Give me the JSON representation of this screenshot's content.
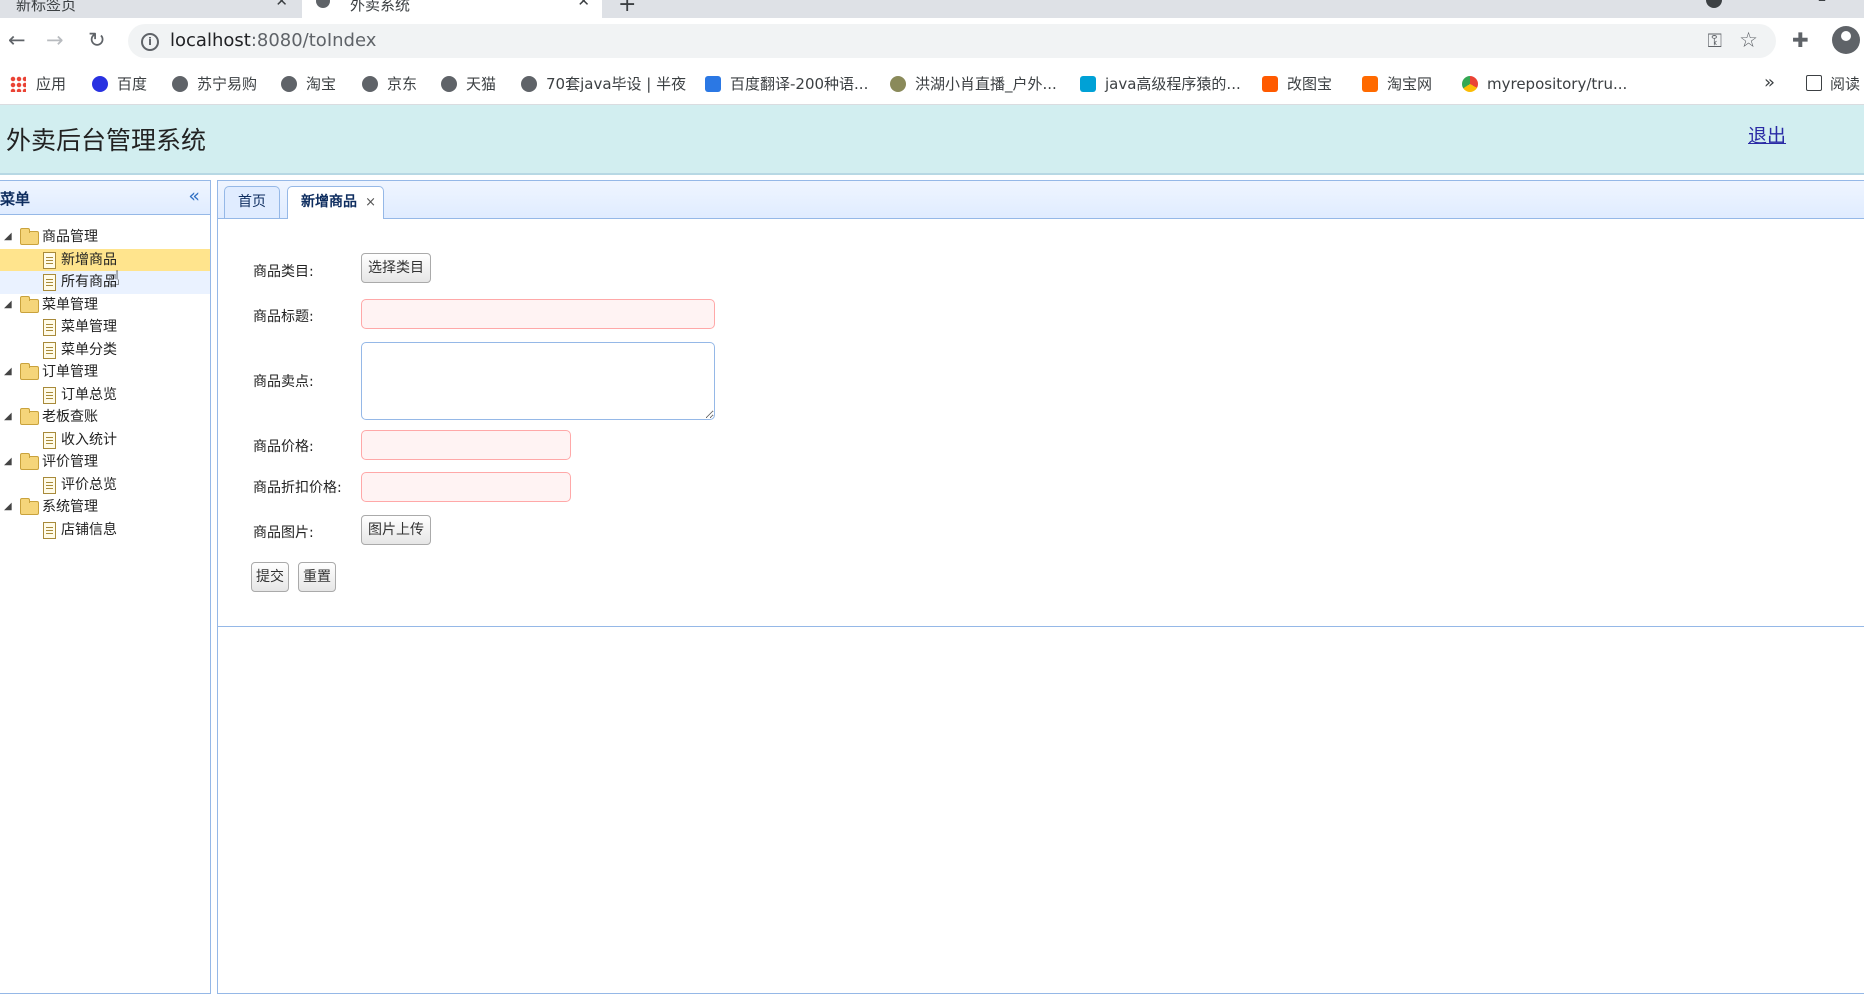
{
  "browser": {
    "tabs": [
      {
        "label": "新标签页",
        "close": "✕"
      },
      {
        "label": "外卖系统",
        "close": "✕"
      }
    ],
    "new_tab": "+",
    "url_host": "localhost",
    "url_path": ":8080/toIndex",
    "bookmarks": [
      {
        "label": "应用",
        "icon": "apps-icon"
      },
      {
        "label": "百度",
        "icon": "baidu-paw-icon",
        "color": "#2932e1"
      },
      {
        "label": "苏宁易购",
        "icon": "globe-icon"
      },
      {
        "label": "淘宝",
        "icon": "globe-icon"
      },
      {
        "label": "京东",
        "icon": "globe-icon"
      },
      {
        "label": "天猫",
        "icon": "globe-icon"
      },
      {
        "label": "70套java毕设 | 半夜",
        "icon": "globe-icon"
      },
      {
        "label": "百度翻译-200种语...",
        "icon": "translate-icon",
        "color": "#2b78e4"
      },
      {
        "label": "洪湖小肖直播_户外...",
        "icon": "bird-icon"
      },
      {
        "label": "java高级程序猿的...",
        "icon": "bilibili-icon",
        "color": "#00a1d6"
      },
      {
        "label": "改图宝",
        "icon": "gaitubao-icon",
        "color": "#ff5a00"
      },
      {
        "label": "淘宝网",
        "icon": "taobao-icon",
        "color": "#ff6a00"
      },
      {
        "label": "myrepository/tru...",
        "icon": "chrome-icon"
      }
    ],
    "more": "»",
    "reader": "阅读"
  },
  "app": {
    "title": "外卖后台管理系统",
    "logout": "退出",
    "menu_title": "菜单",
    "tree": [
      {
        "label": "商品管理",
        "children": [
          "新增商品",
          "所有商品"
        ]
      },
      {
        "label": "菜单管理",
        "children": [
          "菜单管理",
          "菜单分类"
        ]
      },
      {
        "label": "订单管理",
        "children": [
          "订单总览"
        ]
      },
      {
        "label": "老板查账",
        "children": [
          "收入统计"
        ]
      },
      {
        "label": "评价管理",
        "children": [
          "评价总览"
        ]
      },
      {
        "label": "系统管理",
        "children": [
          "店铺信息"
        ]
      }
    ],
    "tabs": {
      "home": "首页",
      "active": "新增商品",
      "close": "×"
    },
    "form": {
      "category_label": "商品类目:",
      "category_button": "选择类目",
      "title_label": "商品标题:",
      "title_value": "",
      "selling_label": "商品卖点:",
      "selling_value": "",
      "price_label": "商品价格:",
      "price_value": "",
      "discount_label": "商品折扣价格:",
      "discount_value": "",
      "image_label": "商品图片:",
      "image_button": "图片上传",
      "submit": "提交",
      "reset": "重置"
    }
  },
  "colors": {
    "header_bg": "#d2eef0",
    "selected_node": "#ffe48d",
    "panel_border": "#95b8e7",
    "invalid_input": "#fff3f3"
  }
}
